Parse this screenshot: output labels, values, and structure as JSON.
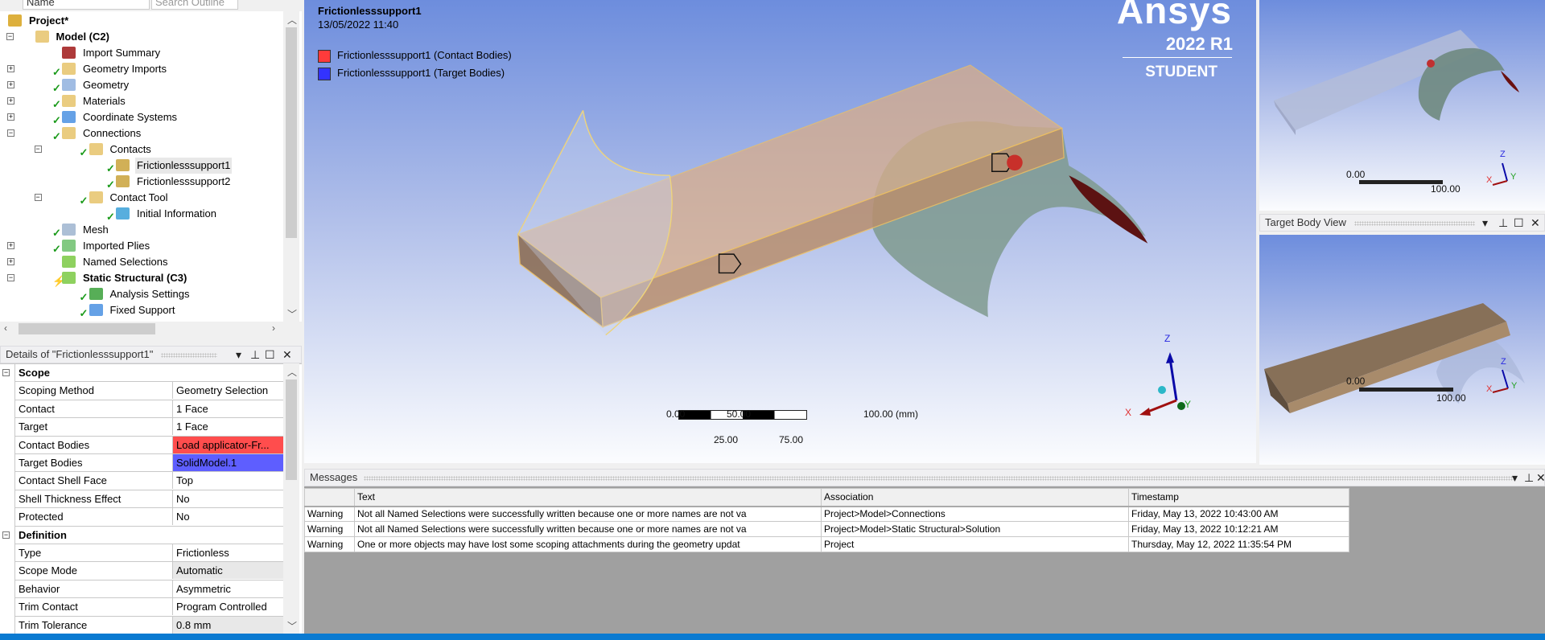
{
  "outline": {
    "name_field": "Name",
    "search_placeholder": "Search Outline",
    "items": [
      {
        "label": "Project*",
        "level": 0,
        "bold": true,
        "expander": "",
        "check": false,
        "icon": "project-icon",
        "color": "#d7a21b"
      },
      {
        "label": "Model (C2)",
        "level": 1,
        "bold": true,
        "expander": "−",
        "check": false,
        "icon": "model-icon",
        "color": "#e6c36a"
      },
      {
        "label": "Import Summary",
        "level": 2,
        "bold": false,
        "expander": "",
        "check": false,
        "icon": "import-summary-icon",
        "color": "#a01818"
      },
      {
        "label": "Geometry Imports",
        "level": 2,
        "bold": false,
        "expander": "+",
        "check": true,
        "icon": "geometry-imports-icon",
        "color": "#e6c36a"
      },
      {
        "label": "Geometry",
        "level": 2,
        "bold": false,
        "expander": "+",
        "check": true,
        "icon": "geometry-icon",
        "color": "#8fb0de"
      },
      {
        "label": "Materials",
        "level": 2,
        "bold": false,
        "expander": "+",
        "check": true,
        "icon": "materials-icon",
        "color": "#e6c36a"
      },
      {
        "label": "Coordinate Systems",
        "level": 2,
        "bold": false,
        "expander": "+",
        "check": true,
        "icon": "coordinate-systems-icon",
        "color": "#4a90e2"
      },
      {
        "label": "Connections",
        "level": 2,
        "bold": false,
        "expander": "−",
        "check": true,
        "icon": "connections-icon",
        "color": "#e6c36a"
      },
      {
        "label": "Contacts",
        "level": 3,
        "bold": false,
        "expander": "−",
        "check": true,
        "icon": "contacts-icon",
        "color": "#e6c36a"
      },
      {
        "label": "Frictionlesssupport1",
        "level": 4,
        "bold": false,
        "expander": "",
        "check": true,
        "icon": "contact-region-icon",
        "color": "#c9a23a",
        "selected": true
      },
      {
        "label": "Frictionlesssupport2",
        "level": 4,
        "bold": false,
        "expander": "",
        "check": true,
        "icon": "contact-region-icon",
        "color": "#c9a23a"
      },
      {
        "label": "Contact Tool",
        "level": 3,
        "bold": false,
        "expander": "−",
        "check": true,
        "icon": "contact-tool-icon",
        "color": "#e6c36a"
      },
      {
        "label": "Initial Information",
        "level": 4,
        "bold": false,
        "expander": "",
        "check": true,
        "icon": "initial-information-icon",
        "color": "#3aa0d8"
      },
      {
        "label": "Mesh",
        "level": 2,
        "bold": false,
        "expander": "",
        "check": true,
        "icon": "mesh-icon",
        "color": "#9db4cf"
      },
      {
        "label": "Imported Plies",
        "level": 2,
        "bold": false,
        "expander": "+",
        "check": true,
        "icon": "imported-plies-icon",
        "color": "#6cbf6c"
      },
      {
        "label": "Named Selections",
        "level": 2,
        "bold": false,
        "expander": "+",
        "check": false,
        "icon": "named-selections-icon",
        "color": "#7ac943"
      },
      {
        "label": "Static Structural (C3)",
        "level": 2,
        "bold": true,
        "expander": "−",
        "check": false,
        "icon": "static-structural-icon",
        "color": "#7ac943",
        "lightning": true
      },
      {
        "label": "Analysis Settings",
        "level": 3,
        "bold": false,
        "expander": "",
        "check": true,
        "icon": "analysis-settings-icon",
        "color": "#3aa03a"
      },
      {
        "label": "Fixed Support",
        "level": 3,
        "bold": false,
        "expander": "",
        "check": true,
        "icon": "fixed-support-icon",
        "color": "#4a90e2"
      }
    ]
  },
  "details": {
    "title": "Details of \"Frictionlesssupport1\"",
    "rows": [
      {
        "type": "category",
        "key": "Scope"
      },
      {
        "key": "Scoping Method",
        "value": "Geometry Selection"
      },
      {
        "key": "Contact",
        "value": "1 Face"
      },
      {
        "key": "Target",
        "value": "1 Face"
      },
      {
        "key": "Contact Bodies",
        "value": "Load applicator-Fr...",
        "bg": "#ff4d4d"
      },
      {
        "key": "Target Bodies",
        "value": "SolidModel.1",
        "bg": "#5e5eff"
      },
      {
        "key": "Contact Shell Face",
        "value": "Top"
      },
      {
        "key": "Shell Thickness Effect",
        "value": "No"
      },
      {
        "key": "Protected",
        "value": "No"
      },
      {
        "type": "category",
        "key": "Definition"
      },
      {
        "key": "Type",
        "value": "Frictionless"
      },
      {
        "key": "Scope Mode",
        "value": "Automatic",
        "bg": "#e8e8e8"
      },
      {
        "key": "Behavior",
        "value": "Asymmetric"
      },
      {
        "key": "Trim Contact",
        "value": "Program Controlled"
      },
      {
        "key": "Trim Tolerance",
        "value": "0.8 mm",
        "bg": "#e8e8e8"
      }
    ]
  },
  "viewport": {
    "title": "Frictionlesssupport1",
    "date": "13/05/2022 11:40",
    "legend": [
      {
        "label": "Frictionlesssupport1 (Contact Bodies)",
        "color": "#ff3b3b"
      },
      {
        "label": "Frictionlesssupport1 (Target Bodies)",
        "color": "#3333ff"
      }
    ],
    "logo": {
      "brand": "Ansys",
      "version": "2022 R1",
      "edition": "STUDENT"
    },
    "scale": {
      "top": [
        "0.00",
        "50.00",
        "100.00 (mm)"
      ],
      "bottom": [
        "25.00",
        "75.00"
      ]
    },
    "axes": {
      "x": "X",
      "y": "Y",
      "z": "Z"
    }
  },
  "contact_view": {
    "scale": [
      "0.00",
      "100.00"
    ],
    "axes": {
      "x": "X",
      "y": "Y",
      "z": "Z"
    }
  },
  "target_view": {
    "title": "Target Body View",
    "scale": [
      "0.00",
      "100.00"
    ],
    "axes": {
      "x": "X",
      "y": "Y",
      "z": "Z"
    }
  },
  "messages": {
    "title": "Messages",
    "columns": [
      "",
      "Text",
      "Association",
      "Timestamp"
    ],
    "rows": [
      {
        "level": "Warning",
        "text": "Not all Named Selections were successfully written because one or more names are not va",
        "association": "Project>Model>Connections",
        "timestamp": "Friday, May 13, 2022 10:43:00 AM"
      },
      {
        "level": "Warning",
        "text": "Not all Named Selections were successfully written because one or more names are not va",
        "association": "Project>Model>Static Structural>Solution",
        "timestamp": "Friday, May 13, 2022 10:12:21 AM"
      },
      {
        "level": "Warning",
        "text": "One or more objects may have lost some scoping attachments during the geometry updat",
        "association": "Project",
        "timestamp": "Thursday, May 12, 2022 11:35:54 PM"
      }
    ]
  }
}
